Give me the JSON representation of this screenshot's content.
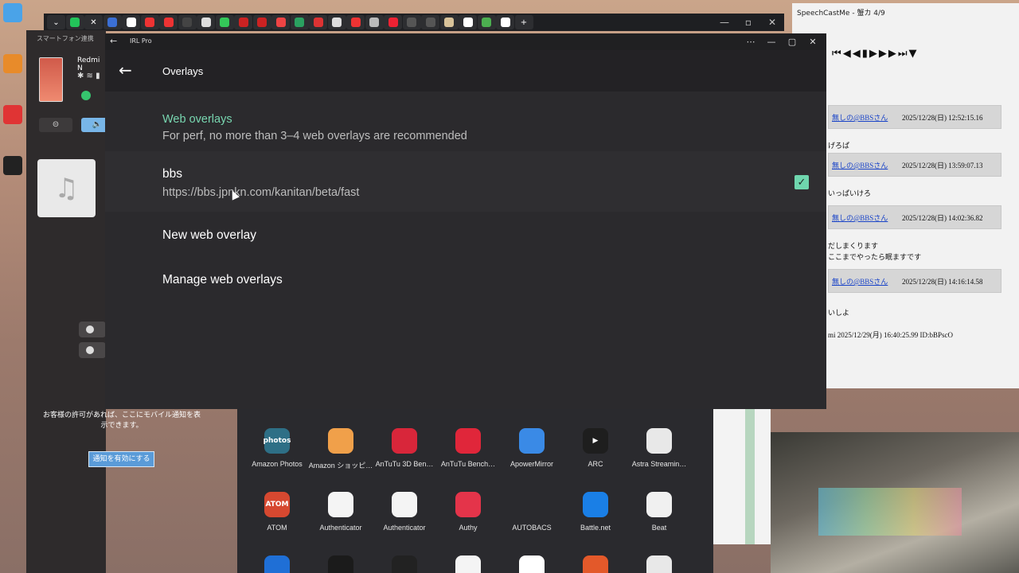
{
  "irl_window": {
    "title": "IRL Pro",
    "appbar_title": "Overlays",
    "category": {
      "title": "Web overlays",
      "subtitle": "For perf, no more than 3–4 web overlays are recommended"
    },
    "overlay_item": {
      "title": "bbs",
      "url": "https://bbs.jpnkn.com/kanitan/beta/fast",
      "checked": true
    },
    "new_overlay": "New web overlay",
    "manage_overlays": "Manage web overlays",
    "accent_color": "#6fd6ae"
  },
  "phone_link": {
    "title": "スマートフォン連携",
    "device_name": "Redmi N",
    "notification_text": "お客様の許可があれば、ここにモバイル通知を表示できます。",
    "notification_button": "通知を有効にする"
  },
  "apps": [
    {
      "label": "Amazon Photos",
      "icon_text": "photos",
      "color": "#2e6f86"
    },
    {
      "label": "Amazon ショッピ…",
      "icon_text": "",
      "color": "#f0a04a"
    },
    {
      "label": "AnTuTu 3D Ben…",
      "icon_text": "",
      "color": "#d8263a"
    },
    {
      "label": "AnTuTu Bench…",
      "icon_text": "",
      "color": "#e0263a"
    },
    {
      "label": "ApowerMirror",
      "icon_text": "",
      "color": "#3a8ae6"
    },
    {
      "label": "ARC",
      "icon_text": "▶",
      "color": "#1e1e1e"
    },
    {
      "label": "Astra Streamin…",
      "icon_text": "",
      "color": "#e8e8e8"
    },
    {
      "label": "ATOM",
      "icon_text": "ATOM",
      "color": "#d64830"
    },
    {
      "label": "Authenticator",
      "icon_text": "",
      "color": "#f4f4f4"
    },
    {
      "label": "Authenticator",
      "icon_text": "",
      "color": "#f4f4f4"
    },
    {
      "label": "Authy",
      "icon_text": "",
      "color": "#e4344a"
    },
    {
      "label": "AUTOBACS",
      "icon_text": "",
      "color": "#2a2a2e"
    },
    {
      "label": "Battle.net",
      "icon_text": "",
      "color": "#1a7fe6"
    },
    {
      "label": "Beat",
      "icon_text": "",
      "color": "#f0f0f0"
    }
  ],
  "speechcast": {
    "title": "SpeechCastMe - 蟹カ 4/9",
    "rows": [
      {
        "name": "無しの@BBSさん",
        "time": "2025/12/28(日) 12:52:15.16"
      },
      {
        "name": "無しの@BBSさん",
        "time": "2025/12/28(日) 13:59:07.13"
      },
      {
        "name": "無しの@BBSさん",
        "time": "2025/12/28(日) 14:02:36.82"
      },
      {
        "name": "無しの@BBSさん",
        "time": "2025/12/28(日) 14:16:14.58"
      }
    ],
    "bodies": [
      "げろぱ",
      "いっぱいけろ",
      "だしまくります",
      "ここまでやったら眠ますです",
      "いしよ",
      "mi 2025/12/29(月) 16:40:25.99 ID:bBPscO"
    ]
  }
}
